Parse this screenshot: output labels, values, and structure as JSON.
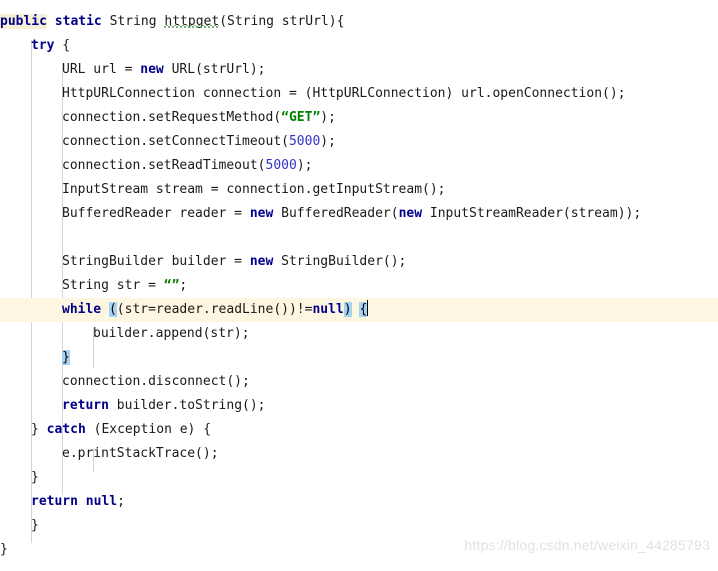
{
  "editor": {
    "language": "Java",
    "colors": {
      "background": "#ffffff",
      "keyword": "#00008b",
      "string": "#008000",
      "number": "#3333cc",
      "text": "#1a1a1a",
      "current_line_highlight": "#fdf6e0",
      "bracket_match_highlight": "#a6d2f4",
      "keyword_occurrence_highlight": "#f5efd5",
      "indent_guide": "#d4d4d4",
      "watermark": "#e2e2e2",
      "spellcheck_underline": "#5aa05a"
    },
    "caret": {
      "line": 14,
      "after_token": "{"
    },
    "current_line": 14
  },
  "watermark": {
    "text": "https://blog.csdn.net/weixin_44285793"
  },
  "code": {
    "lines": [
      {
        "n": 1,
        "indent": 0,
        "tokens": [
          {
            "t": "public",
            "c": "kw-hl"
          },
          {
            "t": " ",
            "c": "plain"
          },
          {
            "t": "static",
            "c": "kw"
          },
          {
            "t": " String ",
            "c": "plain"
          },
          {
            "t": "httpget",
            "c": "wavy"
          },
          {
            "t": "(String strUrl){",
            "c": "plain"
          }
        ]
      },
      {
        "n": 2,
        "indent": 1,
        "tokens": [
          {
            "t": "try",
            "c": "kw"
          },
          {
            "t": " {",
            "c": "plain"
          }
        ]
      },
      {
        "n": 3,
        "indent": 2,
        "tokens": [
          {
            "t": "URL url = ",
            "c": "plain"
          },
          {
            "t": "new",
            "c": "kw"
          },
          {
            "t": " URL(strUrl);",
            "c": "plain"
          }
        ]
      },
      {
        "n": 4,
        "indent": 2,
        "tokens": [
          {
            "t": "HttpURLConnection connection = (HttpURLConnection) url.openConnection();",
            "c": "plain"
          }
        ]
      },
      {
        "n": 5,
        "indent": 2,
        "tokens": [
          {
            "t": "connection.setRequestMethod(",
            "c": "plain"
          },
          {
            "t": "“GET”",
            "c": "str"
          },
          {
            "t": ");",
            "c": "plain"
          }
        ]
      },
      {
        "n": 6,
        "indent": 2,
        "tokens": [
          {
            "t": "connection.setConnectTimeout(",
            "c": "plain"
          },
          {
            "t": "5000",
            "c": "num"
          },
          {
            "t": ");",
            "c": "plain"
          }
        ]
      },
      {
        "n": 7,
        "indent": 2,
        "tokens": [
          {
            "t": "connection.setReadTimeout(",
            "c": "plain"
          },
          {
            "t": "5000",
            "c": "num"
          },
          {
            "t": ");",
            "c": "plain"
          }
        ]
      },
      {
        "n": 8,
        "indent": 2,
        "tokens": [
          {
            "t": "InputStream stream = connection.getInputStream();",
            "c": "plain"
          }
        ]
      },
      {
        "n": 9,
        "indent": 2,
        "tokens": [
          {
            "t": "BufferedReader reader = ",
            "c": "plain"
          },
          {
            "t": "new",
            "c": "kw"
          },
          {
            "t": " BufferedReader(",
            "c": "plain"
          },
          {
            "t": "new",
            "c": "kw"
          },
          {
            "t": " InputStreamReader(stream));",
            "c": "plain"
          }
        ]
      },
      {
        "n": 10,
        "indent": 2,
        "tokens": []
      },
      {
        "n": 11,
        "indent": 2,
        "tokens": [
          {
            "t": "StringBuilder builder = ",
            "c": "plain"
          },
          {
            "t": "new",
            "c": "kw"
          },
          {
            "t": " StringBuilder();",
            "c": "plain"
          }
        ]
      },
      {
        "n": 12,
        "indent": 2,
        "tokens": [
          {
            "t": "String str = ",
            "c": "plain"
          },
          {
            "t": "“”",
            "c": "str"
          },
          {
            "t": ";",
            "c": "plain"
          }
        ]
      },
      {
        "n": 13,
        "indent": 2,
        "current": true,
        "caret_at_end": true,
        "tokens": [
          {
            "t": "while",
            "c": "kw"
          },
          {
            "t": " ",
            "c": "plain"
          },
          {
            "t": "(",
            "c": "brmatch"
          },
          {
            "t": "(str=reader.readLine())!=",
            "c": "plain"
          },
          {
            "t": "null",
            "c": "kw"
          },
          {
            "t": ")",
            "c": "brmatch"
          },
          {
            "t": " ",
            "c": "plain"
          },
          {
            "t": "{",
            "c": "brmatch"
          }
        ]
      },
      {
        "n": 14,
        "indent": 3,
        "tokens": [
          {
            "t": "builder.append(str);",
            "c": "plain"
          }
        ]
      },
      {
        "n": 15,
        "indent": 2,
        "tokens": [
          {
            "t": "}",
            "c": "brmatch"
          }
        ]
      },
      {
        "n": 16,
        "indent": 2,
        "tokens": [
          {
            "t": "connection.disconnect();",
            "c": "plain"
          }
        ]
      },
      {
        "n": 17,
        "indent": 2,
        "tokens": [
          {
            "t": "return",
            "c": "kw"
          },
          {
            "t": " builder.toString();",
            "c": "plain"
          }
        ]
      },
      {
        "n": 18,
        "indent": 1,
        "tokens": [
          {
            "t": "} ",
            "c": "plain"
          },
          {
            "t": "catch",
            "c": "kw"
          },
          {
            "t": " (Exception e) {",
            "c": "plain"
          }
        ]
      },
      {
        "n": 19,
        "indent": 2,
        "tokens": [
          {
            "t": "e.printStackTrace();",
            "c": "plain"
          }
        ]
      },
      {
        "n": 20,
        "indent": 1,
        "tokens": [
          {
            "t": "}",
            "c": "plain"
          }
        ]
      },
      {
        "n": 21,
        "indent": 1,
        "tokens": [
          {
            "t": "return",
            "c": "kw"
          },
          {
            "t": " ",
            "c": "plain"
          },
          {
            "t": "null",
            "c": "kw"
          },
          {
            "t": ";",
            "c": "plain"
          }
        ]
      },
      {
        "n": 22,
        "indent": 1,
        "tokens": [
          {
            "t": "}",
            "c": "plain"
          }
        ]
      },
      {
        "n": 23,
        "indent": 0,
        "tokens": [
          {
            "t": "}",
            "c": "plain"
          }
        ]
      }
    ]
  }
}
